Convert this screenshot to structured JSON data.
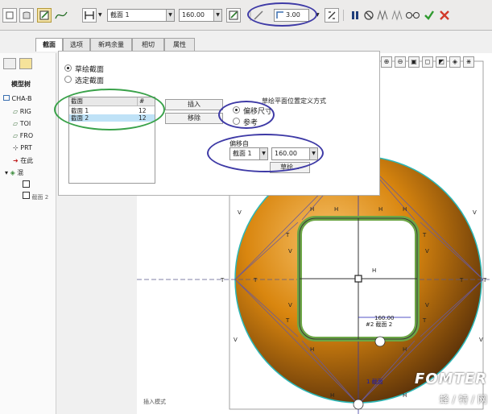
{
  "toolbar": {
    "section_select": "截面 1",
    "value_combo": "160.00",
    "thickness_value": "3.00"
  },
  "tabs": [
    "截面",
    "选项",
    "新鸡余量",
    "相切",
    "属性"
  ],
  "left_panel": {
    "title": "模型树",
    "items": [
      "CHA-B",
      "RIG",
      "TOI",
      "FRO",
      "PRT",
      "在此",
      "混",
      "截面 2"
    ]
  },
  "panel": {
    "radio_sketch": "草绘截面",
    "radio_select": "选定截面",
    "table_header_section": "截面",
    "table_header_num": "#",
    "rows": [
      {
        "name": "截面 1",
        "num": "12"
      },
      {
        "name": "截面 2",
        "num": "12"
      }
    ],
    "insert_button": "插入",
    "remove_button": "移除",
    "plane_method_title": "草绘平面位置定义方式",
    "radio_offset": "偏移尺寸",
    "radio_reference": "参考",
    "offset_from_label": "偏移自",
    "offset_section": "截面 1",
    "offset_value": "160.00",
    "sketch_button": "草绘..."
  },
  "graphics": {
    "dimension_label": "160.00",
    "section_label": "#2 截面 2",
    "section_label_2": "1 截面",
    "insert_mode_label": "插入模式",
    "constraint_labels": {
      "h": "H",
      "v": "V",
      "t": "T"
    }
  },
  "watermark": {
    "brand": "FOMTER",
    "chinese": "蜂 / 特 / 网"
  },
  "colors": {
    "ellipse_blue": "#3e3aa6",
    "ellipse_green": "#3aa24a",
    "sphere_orange": "#d9860f",
    "square_green": "#6ca646"
  },
  "icons": [
    "sketch-icon",
    "curve-icon",
    "solid-icon",
    "pause-icon",
    "no-icon",
    "glasses-icon",
    "check-icon",
    "close-icon"
  ]
}
